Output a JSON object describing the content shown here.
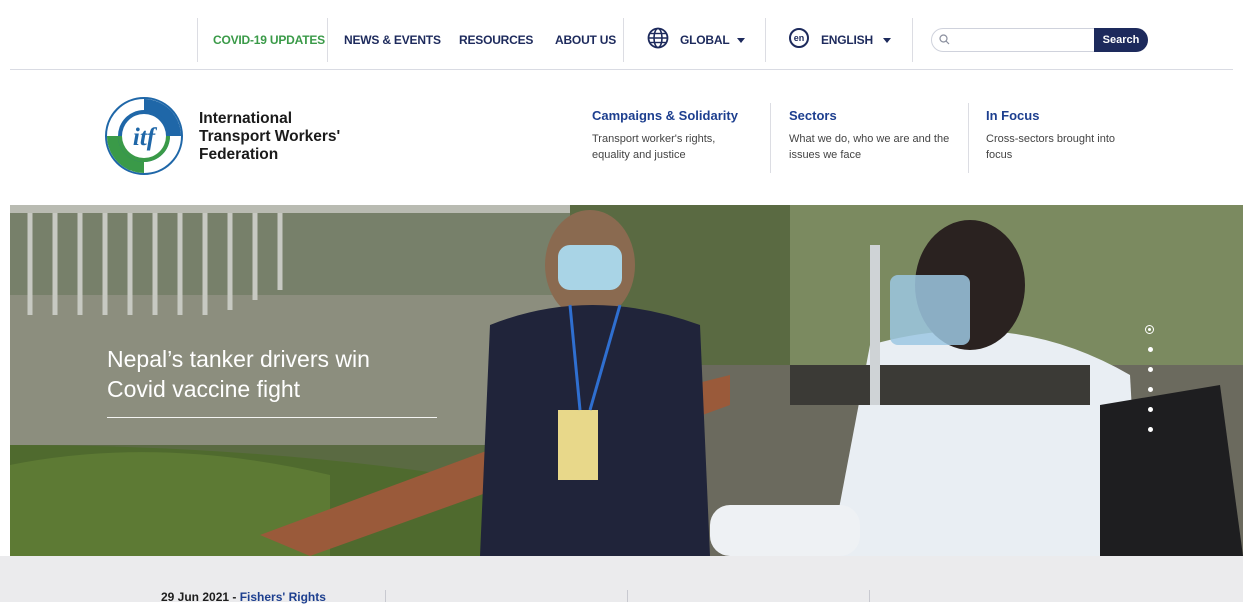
{
  "utility_nav": {
    "links": [
      "COVID-19 UPDATES",
      "NEWS & EVENTS",
      "RESOURCES",
      "ABOUT US"
    ],
    "region": "GLOBAL",
    "language_code": "en",
    "language": "ENGLISH",
    "search_placeholder": "",
    "search_button": "Search"
  },
  "header": {
    "org_name_lines": [
      "International",
      "Transport Workers'",
      "Federation"
    ],
    "nav": [
      {
        "title": "Campaigns & Solidarity",
        "desc_lines": [
          "Transport worker's rights,",
          "equality and justice"
        ]
      },
      {
        "title": "Sectors",
        "desc_lines": [
          "What we do, who we are and the",
          "issues we face"
        ]
      },
      {
        "title": "In Focus",
        "desc_lines": [
          "Cross-sectors brought into",
          "focus"
        ]
      }
    ]
  },
  "hero": {
    "headline_lines": [
      "Nepal’s tanker drivers win",
      "Covid vaccine fight"
    ],
    "slide_count": 6,
    "active_slide": 1
  },
  "news": [
    {
      "date": "29 Jun 2021",
      "sep": " - ",
      "topic": "Fishers' Rights"
    }
  ],
  "colors": {
    "brand_navy": "#1d2a5c",
    "covid_green": "#3a9a48",
    "link_blue": "#1d3f8f"
  }
}
